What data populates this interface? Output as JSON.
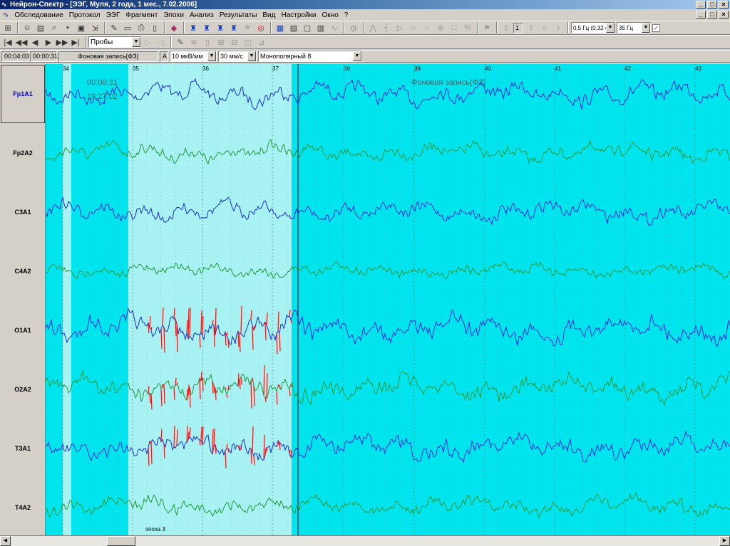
{
  "window": {
    "title": "Нейрон-Спектр - [ЭЭГ, Муля, 2 года, 1 мес., 7.02.2006]",
    "title_buttons": [
      "_",
      "□",
      "×"
    ],
    "mdi_buttons": [
      "_",
      "□",
      "×"
    ]
  },
  "menu": [
    "Обследование",
    "Протокол",
    "ЭЭГ",
    "Фрагмент",
    "Эпохи",
    "Анализ",
    "Результаты",
    "Вид",
    "Настройки",
    "Окно",
    "?"
  ],
  "toolbar1": {
    "page_number": "1",
    "filter_low": "0,5 Гц (0,32 с)",
    "filter_high": "35 Гц"
  },
  "toolbar2": {
    "probes_select": "Пробы"
  },
  "toolbar3": {
    "time_total": "00:04:03",
    "time_current": "00:00:31",
    "record_name": "Фоновая запись(ФЗ)",
    "amp_label": "A",
    "sensitivity": "10 мкВ/мм",
    "speed": "30 мм/с",
    "montage": "Монополярный 8"
  },
  "channels": [
    "Fp1A1",
    "Fp2A2",
    "C3A1",
    "C4A2",
    "O1A1",
    "O2A2",
    "T3A1",
    "T4A2"
  ],
  "active_channel": "Fp1A1",
  "seconds": [
    "34",
    "35",
    "36",
    "37",
    "38",
    "39",
    "40",
    "41",
    "42",
    "43"
  ],
  "overlay": {
    "time": "00:00:31",
    "clock": "19:27:02",
    "record_label": "Фоновая запись(ФЗ)",
    "epoch_label": "эпоха 3"
  },
  "colors": {
    "background": "#00e4ee",
    "selection": "#a8f2f4",
    "trace_blue": "#1a2fd0",
    "trace_green": "#1f9a3a",
    "artifact_red": "#e01818"
  }
}
